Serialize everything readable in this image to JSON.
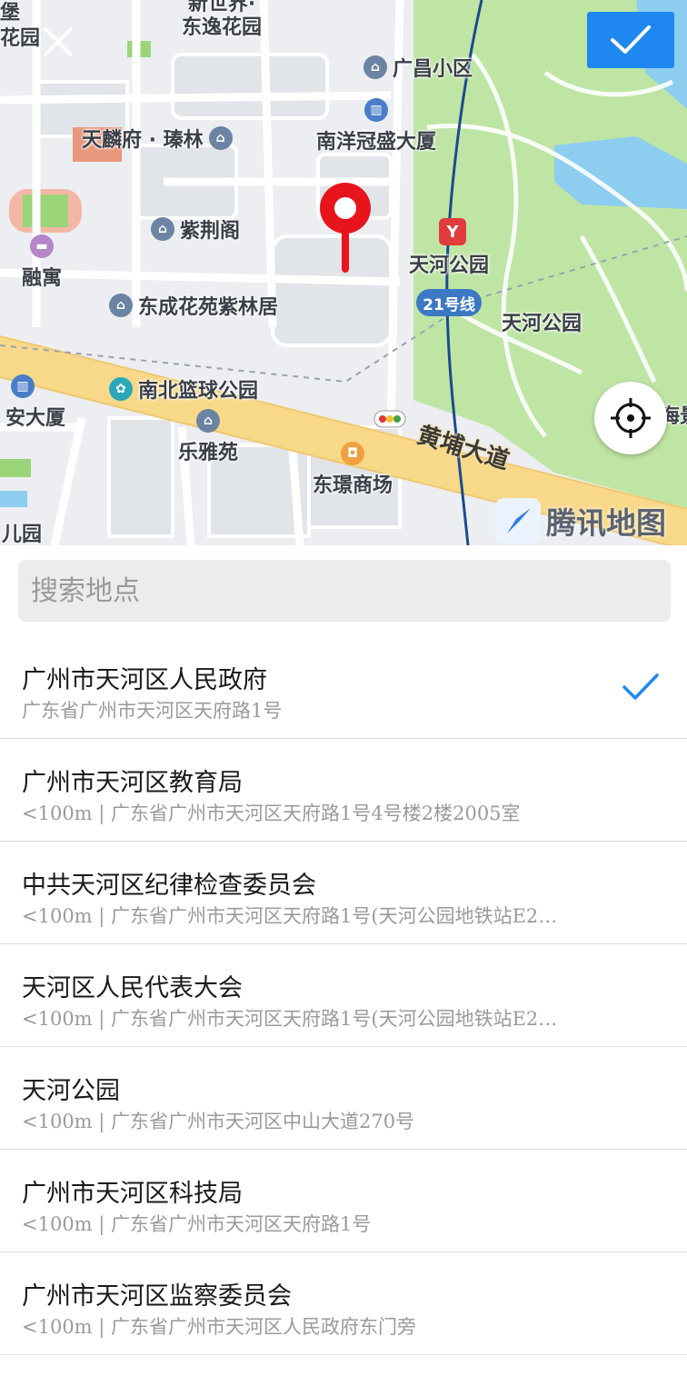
{
  "map": {
    "pois": [
      {
        "label": "新世界·\n东逸花园",
        "icon": "none"
      },
      {
        "label": "广昌小区",
        "icon": "residential-icon"
      },
      {
        "label": "南洋冠盛大厦",
        "icon": "building-icon"
      },
      {
        "label": "天麟府 · 瑧林",
        "icon": "residential-icon"
      },
      {
        "label": "紫荆阁",
        "icon": "residential-icon"
      },
      {
        "label": "融寓",
        "icon": "hotel-icon"
      },
      {
        "label": "东成花苑紫林居",
        "icon": "residential-icon"
      },
      {
        "label": "天河公园",
        "icon": "metro-icon"
      },
      {
        "label": "天河公园",
        "icon": "none"
      },
      {
        "label": "南北篮球公园",
        "icon": "park-icon"
      },
      {
        "label": "安大厦",
        "icon": "building-icon"
      },
      {
        "label": "乐雅苑",
        "icon": "residential-icon"
      },
      {
        "label": "东璟商场",
        "icon": "shopping-icon"
      },
      {
        "label": "儿园",
        "icon": "none"
      },
      {
        "label": "堡",
        "icon": "none"
      },
      {
        "label": "花园",
        "icon": "none"
      },
      {
        "label": "海景",
        "icon": "none"
      }
    ],
    "metro_line": "21号线",
    "road_name": "黄埔大道",
    "brand": "腾讯地图",
    "colors": {
      "confirm": "#1e88f0",
      "pin": "#e8141c",
      "park": "#bfe5a4",
      "main_road": "#f8d98a"
    }
  },
  "search": {
    "placeholder": "搜索地点",
    "value": ""
  },
  "results": [
    {
      "name": "广州市天河区人民政府",
      "address": "广东省广州市天河区天府路1号",
      "selected": true
    },
    {
      "name": "广州市天河区教育局",
      "address": "<100m | 广东省广州市天河区天府路1号4号楼2楼2005室",
      "selected": false
    },
    {
      "name": "中共天河区纪律检查委员会",
      "address": "<100m | 广东省广州市天河区天府路1号(天河公园地铁站E2…",
      "selected": false
    },
    {
      "name": "天河区人民代表大会",
      "address": "<100m | 广东省广州市天河区天府路1号(天河公园地铁站E2…",
      "selected": false
    },
    {
      "name": "天河公园",
      "address": "<100m | 广东省广州市天河区中山大道270号",
      "selected": false
    },
    {
      "name": "广州市天河区科技局",
      "address": "<100m | 广东省广州市天河区天府路1号",
      "selected": false
    },
    {
      "name": "广州市天河区监察委员会",
      "address": "<100m | 广东省广州市天河区人民政府东门旁",
      "selected": false
    }
  ]
}
